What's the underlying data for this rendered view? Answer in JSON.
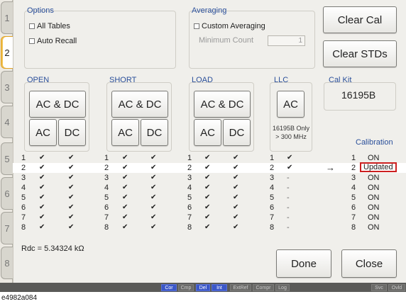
{
  "tabs": [
    "1",
    "2",
    "3",
    "4",
    "5",
    "6",
    "7",
    "8"
  ],
  "active_tab": "2",
  "options": {
    "title": "Options",
    "all_tables": "All Tables",
    "auto_recall": "Auto Recall"
  },
  "averaging": {
    "title": "Averaging",
    "custom_averaging": "Custom Averaging",
    "minimum_count_label": "Minimum Count",
    "minimum_count_value": "1"
  },
  "buttons": {
    "clear_cal": "Clear Cal",
    "clear_stds": "Clear STDs",
    "open_acdc": "AC & DC",
    "open_ac": "AC",
    "open_dc": "DC",
    "short_acdc": "AC & DC",
    "short_ac": "AC",
    "short_dc": "DC",
    "load_acdc": "AC & DC",
    "load_ac": "AC",
    "load_dc": "DC",
    "llc_ac": "AC",
    "done": "Done",
    "close": "Close"
  },
  "columns": {
    "open": "OPEN",
    "short": "SHORT",
    "load": "LOAD",
    "llc": "LLC",
    "cal_kit": "Cal Kit",
    "calibration": "Calibration"
  },
  "llc_note_line1": "16195B Only",
  "llc_note_line2": "> 300 MHz",
  "cal_kit_value": "16195B",
  "arrow": "→",
  "table": [
    {
      "n": "1",
      "o_ac": "✔",
      "o_dc": "✔",
      "s_ac": "✔",
      "s_dc": "✔",
      "l_ac": "✔",
      "l_dc": "✔",
      "llc": "✔",
      "status": "ON"
    },
    {
      "n": "2",
      "o_ac": "✔",
      "o_dc": "✔",
      "s_ac": "✔",
      "s_dc": "✔",
      "l_ac": "✔",
      "l_dc": "✔",
      "llc": "✔",
      "status": "Updated"
    },
    {
      "n": "3",
      "o_ac": "✔",
      "o_dc": "✔",
      "s_ac": "✔",
      "s_dc": "✔",
      "l_ac": "✔",
      "l_dc": "✔",
      "llc": "-",
      "status": "ON"
    },
    {
      "n": "4",
      "o_ac": "✔",
      "o_dc": "✔",
      "s_ac": "✔",
      "s_dc": "✔",
      "l_ac": "✔",
      "l_dc": "✔",
      "llc": "-",
      "status": "ON"
    },
    {
      "n": "5",
      "o_ac": "✔",
      "o_dc": "✔",
      "s_ac": "✔",
      "s_dc": "✔",
      "l_ac": "✔",
      "l_dc": "✔",
      "llc": "-",
      "status": "ON"
    },
    {
      "n": "6",
      "o_ac": "✔",
      "o_dc": "✔",
      "s_ac": "✔",
      "s_dc": "✔",
      "l_ac": "✔",
      "l_dc": "✔",
      "llc": "-",
      "status": "ON"
    },
    {
      "n": "7",
      "o_ac": "✔",
      "o_dc": "✔",
      "s_ac": "✔",
      "s_dc": "✔",
      "l_ac": "✔",
      "l_dc": "✔",
      "llc": "-",
      "status": "ON"
    },
    {
      "n": "8",
      "o_ac": "✔",
      "o_dc": "✔",
      "s_ac": "✔",
      "s_dc": "✔",
      "l_ac": "✔",
      "l_dc": "✔",
      "llc": "-",
      "status": "ON"
    }
  ],
  "rdc": "Rdc = 5.34324 kΩ",
  "status_bar": [
    "Cor",
    "Cmp",
    "Del",
    "Int",
    "ExtRef",
    "Compr",
    "Log",
    "Svc",
    "Ovld"
  ],
  "status_on": [
    "Cor",
    "Del",
    "Int"
  ],
  "caption": "e4982a084",
  "colors": {
    "accent": "#2a4f9a",
    "highlight_border": "#cc2020",
    "status_on": "#3b57c8"
  }
}
